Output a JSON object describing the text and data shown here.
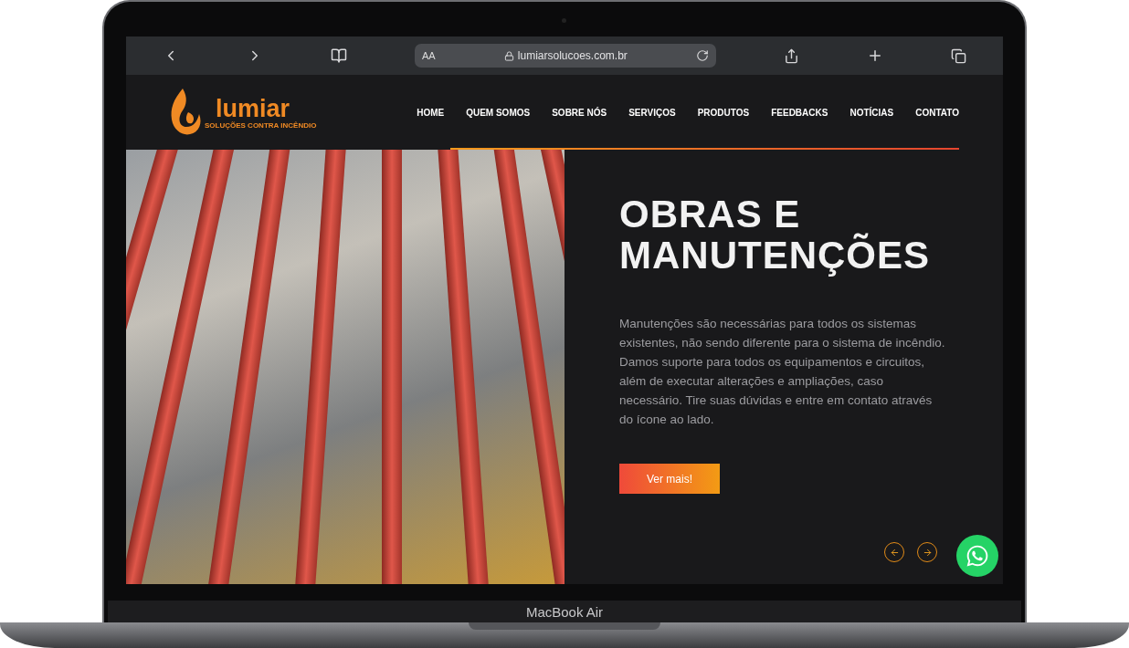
{
  "browser": {
    "reader_label": "AA",
    "url": "lumiarsolucoes.com.br"
  },
  "header": {
    "logo": {
      "name": "lumiar",
      "tagline": "SOLUÇÕES CONTRA INCÊNDIO"
    },
    "nav": [
      "HOME",
      "QUEM SOMOS",
      "SOBRE NÓS",
      "SERVIÇOS",
      "PRODUTOS",
      "FEEDBACKS",
      "NOTÍCIAS",
      "CONTATO"
    ]
  },
  "hero": {
    "title": "OBRAS E MANUTENÇÕES",
    "text": "Manutenções são necessárias para todos os sistemas existentes, não sendo diferente para o sistema de incêndio. Damos suporte para todos os equipamentos e circuitos, além de executar alterações e ampliações, caso necessário. Tire suas dúvidas e entre em contato através do ícone ao lado.",
    "button": "Ver mais!"
  },
  "laptop": {
    "label": "MacBook Air"
  }
}
